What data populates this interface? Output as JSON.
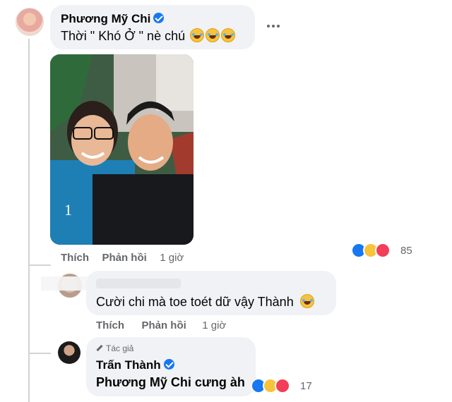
{
  "comment1": {
    "author": "Phương Mỹ Chi",
    "text": "Thời \" Khó Ở \" nè chú",
    "emoji_icons": [
      "rofl-emoji-icon",
      "rofl-emoji-icon",
      "rofl-emoji-icon"
    ],
    "like_label": "Thích",
    "reply_label": "Phản hồi",
    "time": "1 giờ",
    "reaction_count": "85",
    "reaction_icons": [
      "like-reaction-icon",
      "haha-reaction-icon",
      "love-reaction-icon"
    ]
  },
  "comment2": {
    "text": "Cười chi mà toe toét dữ vậy Thành",
    "emoji_icon": "smile-emoji-icon",
    "like_label": "Thích",
    "reply_label": "Phản hồi",
    "time": "1 giờ"
  },
  "comment3": {
    "badge": "Tác giả",
    "author": "Trấn Thành",
    "text": "Phương Mỹ Chi cưng àh",
    "reaction_count": "17",
    "reaction_icons": [
      "like-reaction-icon",
      "care-reaction-icon",
      "love-reaction-icon"
    ]
  },
  "colors": {
    "bubble": "#f0f2f5",
    "verified": "#1877f2",
    "secondary_text": "#65676b"
  }
}
